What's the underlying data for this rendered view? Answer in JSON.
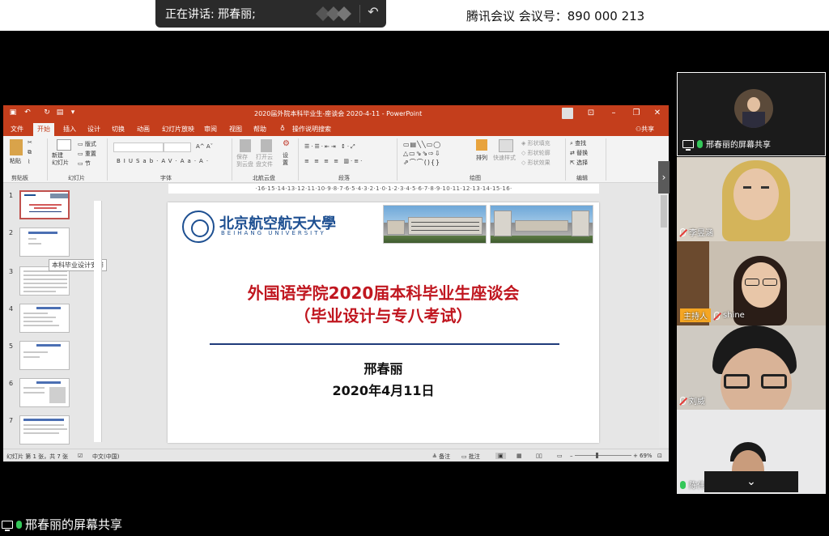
{
  "meeting": {
    "speaking": "正在讲话: 邢春丽;",
    "meeting_id": "腾讯会议 会议号：890 000 213",
    "bottom_share_label": "邢春丽的屏幕共享"
  },
  "ppt": {
    "window_title": "2020届外院本科毕业生-座谈会 2020-4-11 - PowerPoint",
    "tabs": [
      "文件",
      "开始",
      "插入",
      "设计",
      "切换",
      "动画",
      "幻灯片放映",
      "审阅",
      "视图",
      "帮助",
      "操作说明搜索"
    ],
    "active_tab": "开始",
    "share_label": "共享",
    "ribbon": {
      "paste": "粘贴",
      "clipboard": "剪贴板",
      "new_slide": "新建\n幻灯片",
      "layout": "版式",
      "reset": "重置",
      "section": "节",
      "slides_group": "幻灯片",
      "font_group": "字体",
      "cloud_save": "保存\n到云盘",
      "cloud_open": "打开云\n盘文件",
      "settings": "设\n置",
      "cloud_group": "北航云盘",
      "paragraph_group": "段落",
      "arrange": "排列",
      "quick_styles": "快速样式",
      "shape_fill": "形状填充",
      "shape_outline": "形状轮廓",
      "shape_effects": "形状效果",
      "drawing_group": "绘图",
      "find": "查找",
      "replace": "替换",
      "select": "选择",
      "editing_group": "编辑"
    },
    "thumbnail_tooltip": "本科毕业设计安排",
    "thumb_numbers": [
      "1",
      "2",
      "3",
      "4",
      "5",
      "6",
      "7"
    ],
    "ruler": "·16·15·14·13·12·11·10·9·8·7·6·5·4·3·2·1·0·1·2·3·4·5·6·7·8·9·10·11·12·13·14·15·16·",
    "status": {
      "slide_info": "幻灯片 第 1 张，共 7 张",
      "language": "中文(中国)",
      "notes": "备注",
      "comments": "批注",
      "zoom": "69%"
    }
  },
  "slide": {
    "logo_cn": "北京航空航天大學",
    "logo_en": "BEIHANG UNIVERSITY",
    "title_line1": "外国语学院2020届本科毕业生座谈会",
    "title_line2": "（毕业设计与专八考试）",
    "author": "邢春丽",
    "date": "2020年4月11日"
  },
  "participants": [
    {
      "name": "邢春丽的屏幕共享",
      "role": "screen-share"
    },
    {
      "name": "李昱涵",
      "muted": true
    },
    {
      "name": "shine",
      "muted": true,
      "host_badge": "主持人"
    },
    {
      "name": "刘威",
      "muted": true
    },
    {
      "name": "陈伟东",
      "muted": false
    }
  ],
  "colors": {
    "ppt_accent": "#c43e1c",
    "slide_title_red": "#c0161f",
    "beihang_blue": "#1d4f91",
    "host_orange": "#f5a623",
    "mic_green": "#34c759"
  }
}
